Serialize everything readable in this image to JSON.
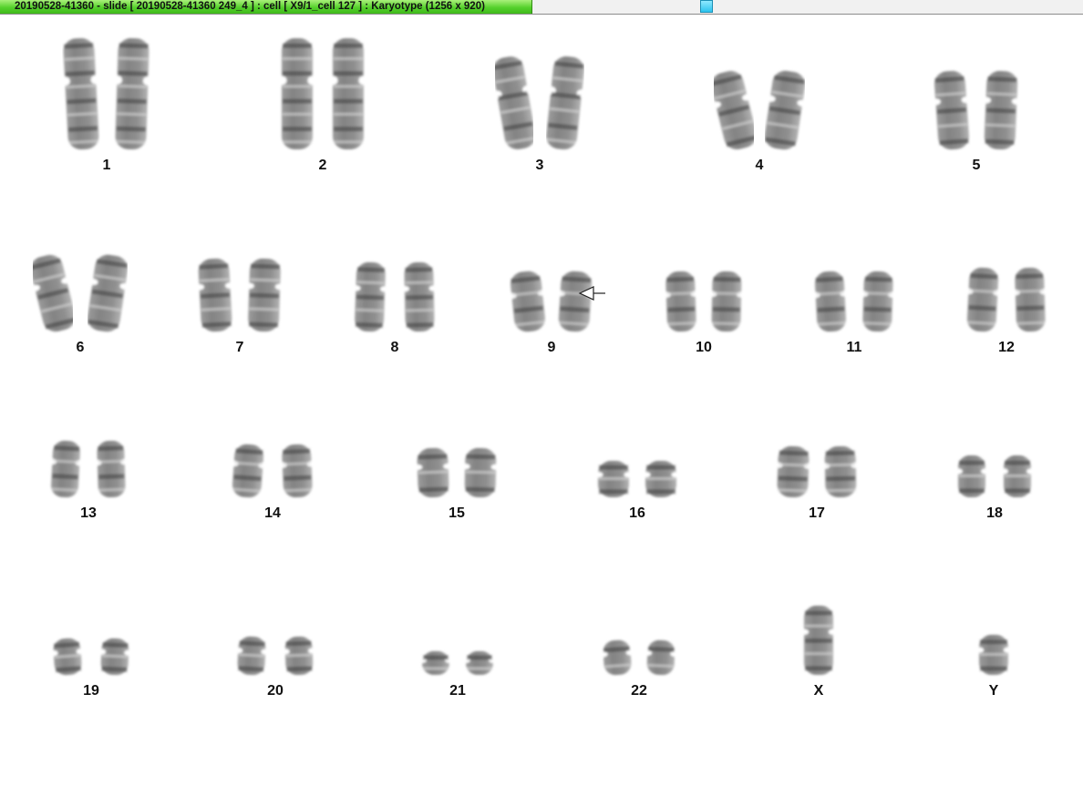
{
  "window": {
    "title": "20190528-41360 - slide [ 20190528-41360 249_4 ] : cell [ X9/1_cell 127 ] : Karyotype  (1256 x 920)"
  },
  "colors": {
    "title_tab": "#55d12c",
    "chromosome_light": "#c9c9c9",
    "chromosome_dark": "#5e5e5e"
  },
  "karyotype": {
    "marker": {
      "chromosome": "9",
      "icon": "arrow-left-icon"
    },
    "chromosomes": [
      {
        "label": "1",
        "count": 2
      },
      {
        "label": "2",
        "count": 2
      },
      {
        "label": "3",
        "count": 2
      },
      {
        "label": "4",
        "count": 2
      },
      {
        "label": "5",
        "count": 2
      },
      {
        "label": "6",
        "count": 2
      },
      {
        "label": "7",
        "count": 2
      },
      {
        "label": "8",
        "count": 2
      },
      {
        "label": "9",
        "count": 2
      },
      {
        "label": "10",
        "count": 2
      },
      {
        "label": "11",
        "count": 2
      },
      {
        "label": "12",
        "count": 2
      },
      {
        "label": "13",
        "count": 2
      },
      {
        "label": "14",
        "count": 2
      },
      {
        "label": "15",
        "count": 2
      },
      {
        "label": "16",
        "count": 2
      },
      {
        "label": "17",
        "count": 2
      },
      {
        "label": "18",
        "count": 2
      },
      {
        "label": "19",
        "count": 2
      },
      {
        "label": "20",
        "count": 2
      },
      {
        "label": "21",
        "count": 2
      },
      {
        "label": "22",
        "count": 2
      },
      {
        "label": "X",
        "count": 1
      },
      {
        "label": "Y",
        "count": 1
      }
    ]
  }
}
